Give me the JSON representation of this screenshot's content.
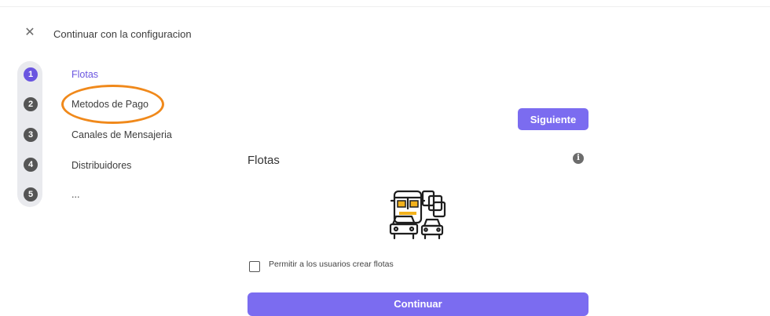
{
  "header": {
    "close_icon": "close-icon",
    "title": "Continuar con la configuracion"
  },
  "stepper": {
    "steps": [
      {
        "number": "1",
        "label": "Flotas",
        "active": true
      },
      {
        "number": "2",
        "label": "Metodos de Pago",
        "active": false,
        "highlighted": true
      },
      {
        "number": "3",
        "label": "Canales de Mensajeria",
        "active": false
      },
      {
        "number": "4",
        "label": "Distribuidores",
        "active": false
      },
      {
        "number": "5",
        "label": "...",
        "active": false
      }
    ]
  },
  "panel": {
    "next_label": "Siguiente",
    "title": "Flotas",
    "info_icon": "i",
    "illustration": "fleet-vehicles-icon",
    "checkbox_label": "Permitir a los usuarios crear flotas",
    "checkbox_checked": false,
    "continue_label": "Continuar"
  },
  "colors": {
    "accent": "#6a55e0",
    "button": "#7b6cf0",
    "highlight_ring": "#f0891b"
  }
}
